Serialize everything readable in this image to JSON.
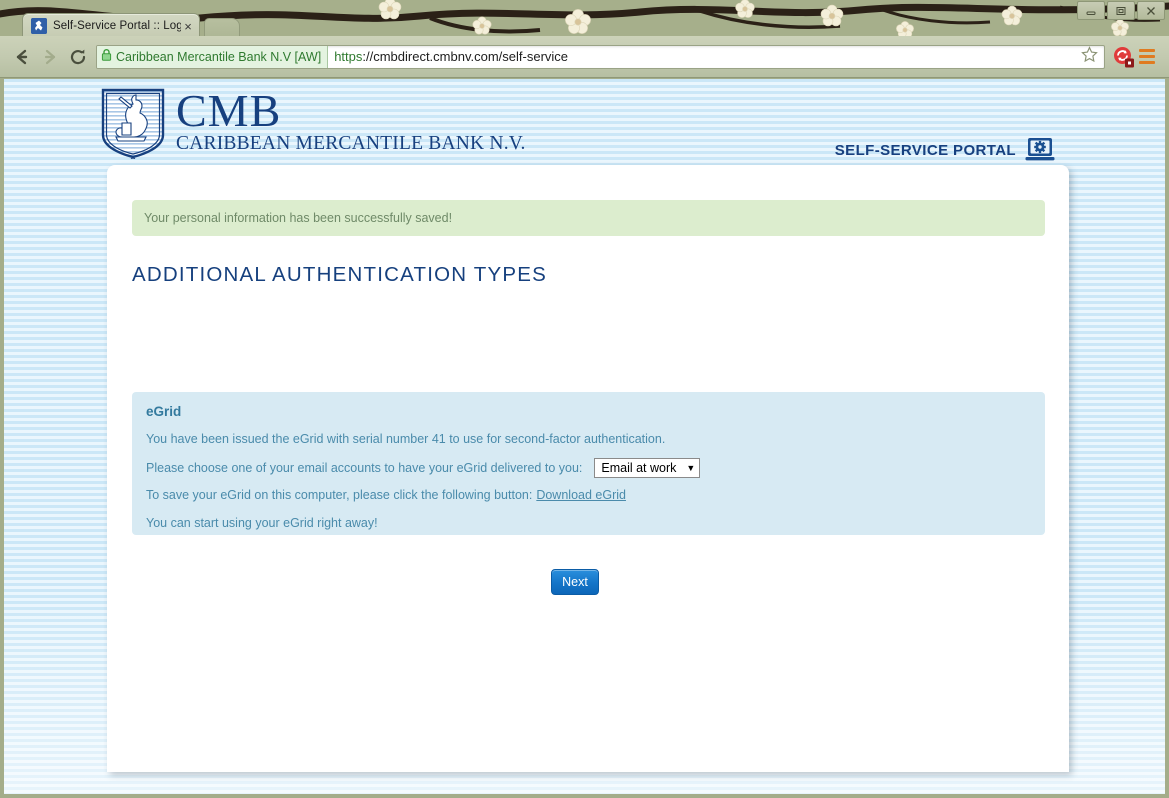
{
  "browser": {
    "tab": {
      "title": "Self-Service Portal :: Log In",
      "close_label": "×"
    },
    "nav": {
      "back_icon": "back-arrow-icon",
      "forward_icon": "forward-arrow-icon",
      "reload_icon": "reload-icon",
      "lock_icon": "padlock-icon",
      "security_label": "Caribbean Mercantile Bank N.V [AW]",
      "url_scheme": "https",
      "url_rest": "://cmbdirect.cmbnv.com/self-service",
      "star_icon": "star-bookmark-icon",
      "extension_icon": "sync-extension-icon",
      "menu_icon": "hamburger-menu-icon"
    },
    "window_controls": {
      "minimize": "minimize-button",
      "maximize": "maximize-button",
      "close": "close-button"
    }
  },
  "page": {
    "logo": {
      "acronym": "CMB",
      "full_name": "CARIBBEAN MERCANTILE BANK N.V.",
      "crest_icon": "bank-crest-lion-icon"
    },
    "portal": {
      "label": "SELF-SERVICE PORTAL",
      "icon": "laptop-gear-icon"
    },
    "alert": {
      "message": "Your personal information has been successfully saved!",
      "background": "#dcedce",
      "text_color": "#6f8a68"
    },
    "section_title": "ADDITIONAL AUTHENTICATION TYPES",
    "egrid": {
      "title": "eGrid",
      "line_serial": "You have been issued the eGrid with serial number 41 to use for second-factor authentication.",
      "line_choose": "Please choose one of your email accounts to have your eGrid delivered to you:",
      "select_value": "Email at work",
      "select_caret": "▼",
      "line_save_prefix": "To save your eGrid on this computer, please click the following button:",
      "download_link": "Download eGrid",
      "line_ready": "You can start using your eGrid right away!",
      "background": "#d7eaf3",
      "title_color": "#337a9e",
      "text_color": "#4a8bab"
    },
    "next_button": "Next",
    "accent_color": "#16407e"
  }
}
